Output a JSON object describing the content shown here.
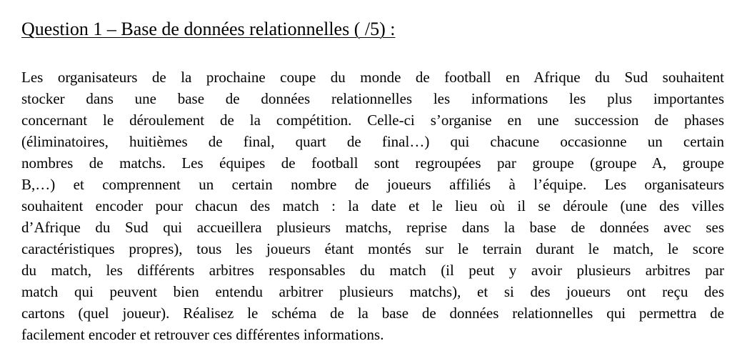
{
  "document": {
    "title": "Question 1 – Base de données relationnelles ( /5) :",
    "paragraph_lines": [
      "Les organisateurs de la prochaine coupe du monde de football en Afrique du Sud souhaitent",
      "stocker dans une base de données relationnelles les informations les plus importantes",
      "concernant le déroulement de la compétition. Celle-ci s’organise en une succession de phases",
      "(éliminatoires, huitièmes de final, quart de final…) qui chacune occasionne un certain",
      "nombres de matchs. Les équipes de football sont regroupées par groupe (groupe A, groupe",
      "B,…) et comprennent un certain nombre de joueurs affiliés à l’équipe. Les organisateurs",
      "souhaitent encoder pour chacun des match : la date et le lieu où il se déroule (une des villes",
      "d’Afrique du Sud qui accueillera plusieurs matchs, reprise dans la base de données avec ses",
      "caractéristiques propres), tous les joueurs étant montés sur le terrain durant le match, le score",
      "du match, les différents arbitres responsables du match (il peut y avoir plusieurs arbitres par",
      "match qui peuvent bien entendu arbitrer plusieurs matchs), et si des joueurs ont reçu des",
      "cartons (quel joueur). Réalisez le schéma de la base de données relationnelles qui permettra de",
      "facilement encoder et retrouver ces différentes informations."
    ]
  }
}
